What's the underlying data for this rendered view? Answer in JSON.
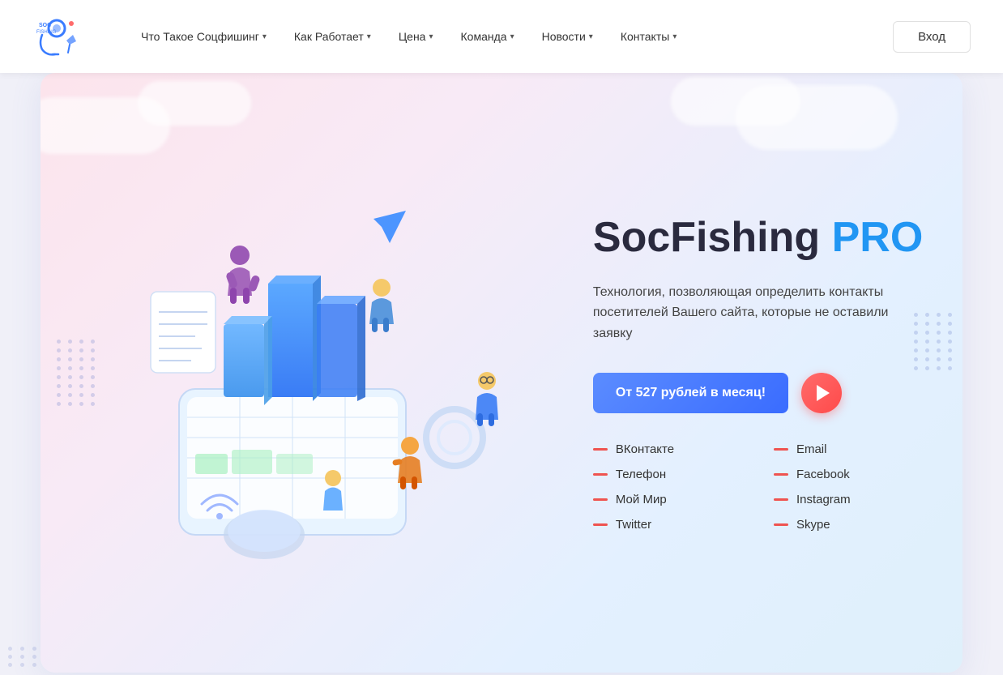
{
  "header": {
    "logo_text": "SOC FISHING",
    "nav_items": [
      {
        "label": "Что Такое Соцфишинг",
        "has_dropdown": true
      },
      {
        "label": "Как Работает",
        "has_dropdown": true
      },
      {
        "label": "Цена",
        "has_dropdown": true
      },
      {
        "label": "Команда",
        "has_dropdown": true
      },
      {
        "label": "Новости",
        "has_dropdown": true
      },
      {
        "label": "Контакты",
        "has_dropdown": true
      }
    ],
    "login_button": "Вход"
  },
  "hero": {
    "title_main": "SocFishing ",
    "title_pro": "PRO",
    "subtitle": "Технология, позволяющая определить контакты посетителей Вашего сайта, которые не оставили заявку",
    "cta_button": "От 527 рублей в месяц!",
    "features": [
      {
        "col": 1,
        "items": [
          "ВКонтакте",
          "Телефон",
          "Мой Мир",
          "Twitter"
        ]
      },
      {
        "col": 2,
        "items": [
          "Email",
          "Facebook",
          "Instagram",
          "Skype"
        ]
      }
    ]
  },
  "colors": {
    "accent_blue": "#2196f3",
    "accent_red": "#ef5350",
    "title_dark": "#2a2a3e",
    "text_gray": "#444444"
  }
}
